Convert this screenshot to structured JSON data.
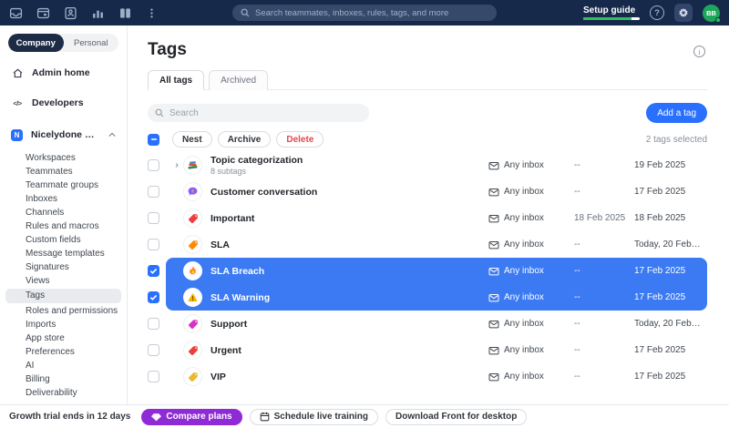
{
  "topbar": {
    "search_placeholder": "Search teammates, inboxes, rules, tags, and more",
    "setup_guide_label": "Setup guide",
    "setup_progress_pct": 86,
    "avatar_initials": "BB",
    "help_glyph": "?"
  },
  "sidebar": {
    "toggle": {
      "company": "Company",
      "personal": "Personal"
    },
    "admin_home": "Admin home",
    "developers": "Developers",
    "workspace": {
      "initial": "N",
      "label": "Nicelydone Wor..."
    },
    "sub_items": [
      "Workspaces",
      "Teammates",
      "Teammate groups",
      "Inboxes",
      "Channels",
      "Rules and macros",
      "Custom fields",
      "Message templates",
      "Signatures",
      "Views",
      "Tags",
      "Roles and permissions",
      "Imports",
      "App store",
      "Preferences",
      "AI",
      "Billing",
      "Deliverability"
    ],
    "active_item": "Tags"
  },
  "main": {
    "title": "Tags",
    "tabs": [
      {
        "label": "All tags",
        "active": true
      },
      {
        "label": "Archived",
        "active": false
      }
    ],
    "search_placeholder": "Search",
    "add_button": "Add a tag",
    "toolbar": {
      "nest": "Nest",
      "archive": "Archive",
      "delete": "Delete",
      "selected_text": "2 tags selected"
    },
    "table": {
      "rows": [
        {
          "icon": "books",
          "name": "Topic categorization",
          "subtitle": "8 subtags",
          "expandable": true,
          "checked": false,
          "selected": false,
          "inbox": "Any inbox",
          "col2": "--",
          "col3": "19 Feb 2025"
        },
        {
          "icon": "speech",
          "name": "Customer conversation",
          "subtitle": "",
          "expandable": false,
          "checked": false,
          "selected": false,
          "inbox": "Any inbox",
          "col2": "--",
          "col3": "17 Feb 2025"
        },
        {
          "icon": "tag-red",
          "name": "Important",
          "subtitle": "",
          "expandable": false,
          "checked": false,
          "selected": false,
          "inbox": "Any inbox",
          "col2": "18 Feb 2025",
          "col3": "18 Feb 2025"
        },
        {
          "icon": "tag-orange",
          "name": "SLA",
          "subtitle": "",
          "expandable": false,
          "checked": false,
          "selected": false,
          "inbox": "Any inbox",
          "col2": "--",
          "col3": "Today, 20 Feb…"
        },
        {
          "icon": "fire",
          "name": "SLA Breach",
          "subtitle": "",
          "expandable": false,
          "checked": true,
          "selected": true,
          "inbox": "Any inbox",
          "col2": "--",
          "col3": "17 Feb 2025"
        },
        {
          "icon": "warning",
          "name": "SLA Warning",
          "subtitle": "",
          "expandable": false,
          "checked": true,
          "selected": true,
          "inbox": "Any inbox",
          "col2": "--",
          "col3": "17 Feb 2025"
        },
        {
          "icon": "tag-pink",
          "name": "Support",
          "subtitle": "",
          "expandable": false,
          "checked": false,
          "selected": false,
          "inbox": "Any inbox",
          "col2": "--",
          "col3": "Today, 20 Feb…"
        },
        {
          "icon": "tag-red",
          "name": "Urgent",
          "subtitle": "",
          "expandable": false,
          "checked": false,
          "selected": false,
          "inbox": "Any inbox",
          "col2": "--",
          "col3": "17 Feb 2025"
        },
        {
          "icon": "tag-yellow",
          "name": "VIP",
          "subtitle": "",
          "expandable": false,
          "checked": false,
          "selected": false,
          "inbox": "Any inbox",
          "col2": "--",
          "col3": "17 Feb 2025"
        }
      ]
    }
  },
  "footer": {
    "trial_text": "Growth trial ends in 12 days",
    "compare_plans": "Compare plans",
    "schedule_training": "Schedule live training",
    "download_desktop": "Download Front for desktop"
  },
  "colors": {
    "topbar_navy": "#17294a",
    "accent_blue": "#2970ff",
    "selection_blue": "#3b7af2",
    "danger_red": "#e5484d",
    "success_green": "#2fbf5f",
    "purple": "#8f2bd6"
  }
}
